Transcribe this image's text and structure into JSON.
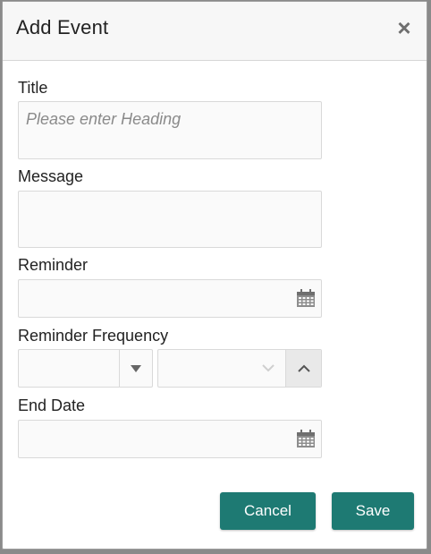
{
  "dialog": {
    "title": "Add Event",
    "close_symbol": "×"
  },
  "form": {
    "title_label": "Title",
    "title_placeholder": "Please enter Heading",
    "message_label": "Message",
    "reminder_label": "Reminder",
    "frequency_label": "Reminder Frequency",
    "end_date_label": "End Date"
  },
  "actions": {
    "cancel_label": "Cancel",
    "save_label": "Save"
  },
  "theme": {
    "primary_color": "#1e7a73"
  },
  "icons": {
    "close": "close-icon",
    "reminder_date": "calendar-icon",
    "end_date": "calendar-icon",
    "select_arrow": "caret-down-icon",
    "stepper_down": "chevron-down-icon",
    "stepper_up": "chevron-up-icon"
  }
}
